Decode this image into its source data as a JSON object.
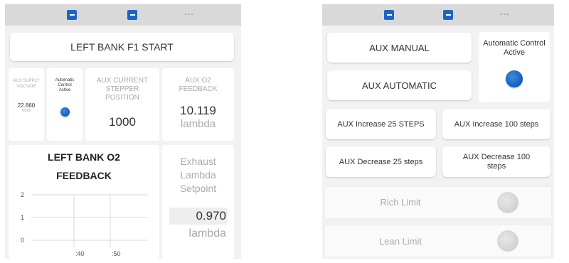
{
  "left": {
    "topbar": {
      "dash": "---"
    },
    "start_button": "LEFT BANK F1 START",
    "aux_supply": {
      "label": "AUX SUPPLY VOLTAGE",
      "value": "22.860",
      "unit": "Volts"
    },
    "auto_small": {
      "label": "Automatic Control Active"
    },
    "stepper": {
      "label": "AUX CURRENT STEPPER POSITION",
      "value": "1000"
    },
    "o2_feedback": {
      "label": "AUX O2 FEEDBACK",
      "value": "10.119",
      "unit": "lambda"
    },
    "chart_title": "LEFT BANK O2 FEEDBACK",
    "setpoint": {
      "label": "Exhaust Lambda Setpoint",
      "value": "0.970",
      "unit": "lambda"
    }
  },
  "chart_data": {
    "type": "line",
    "title": "LEFT BANK O2 FEEDBACK",
    "xlabel": "",
    "ylabel": "",
    "y_ticks": [
      "2",
      "1",
      "0"
    ],
    "x_ticks": [
      ":40",
      ":50"
    ],
    "ylim": [
      0,
      2
    ],
    "series": [],
    "grid": true
  },
  "right": {
    "topbar": {
      "dash": "---"
    },
    "aux_manual": "AUX MANUAL",
    "aux_automatic": "AUX AUTOMATIC",
    "auto_indicator_label": "Automatic Control Active",
    "inc25": "AUX Increase 25 STEPS",
    "inc100": "AUX Increase 100 steps",
    "dec25": "AUX Decrease 25 steps",
    "dec100": "AUX Decrease 100 steps",
    "rich_limit": "Rich Limit",
    "lean_limit": "Lean Limit"
  },
  "colors": {
    "accent": "#1e64c8",
    "led_on": "#1565c0",
    "led_off": "#d2d2d2",
    "panel_bg": "#f2f2f2"
  }
}
